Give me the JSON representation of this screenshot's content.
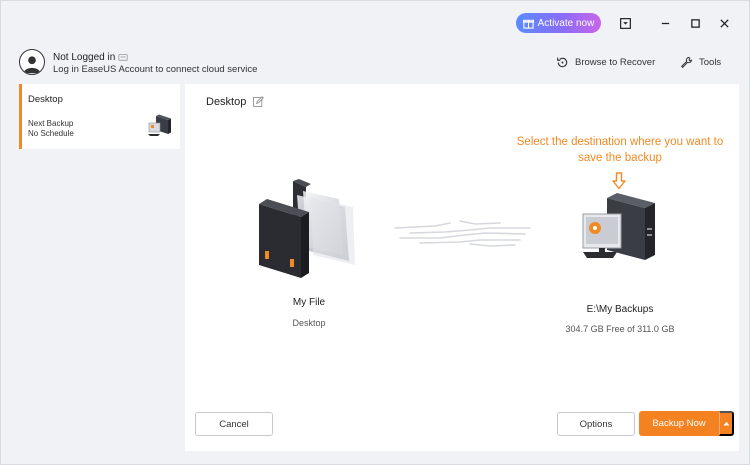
{
  "titlebar": {
    "activate_label": "Activate now"
  },
  "account": {
    "name": "Not Logged in",
    "subtitle": "Log in EaseUS Account to connect cloud service"
  },
  "top_actions": {
    "browse_label": "Browse to Recover",
    "tools_label": "Tools"
  },
  "sidebar": {
    "task": {
      "title": "Desktop",
      "next_backup_label": "Next Backup",
      "schedule_label": "No Schedule"
    }
  },
  "main": {
    "title": "Desktop",
    "source": {
      "name": "My File",
      "sub": "Desktop"
    },
    "destination": {
      "hint": "Select the destination where you want to save the backup",
      "name": "E:\\My Backups",
      "space": "304.7 GB Free of 311.0 GB"
    },
    "buttons": {
      "cancel": "Cancel",
      "options": "Options",
      "backup_now": "Backup Now"
    }
  },
  "icons": {
    "activate": "gift-icon",
    "dropdown_menu": "menu-dropdown-icon",
    "minimize": "minimize-icon",
    "maximize": "maximize-icon",
    "close": "close-icon",
    "avatar": "user-avatar-icon",
    "cloud": "cloud-icon",
    "browse": "restore-icon",
    "tools": "wrench-icon",
    "edit": "edit-icon",
    "source": "file-folder-icon",
    "destination": "computer-disk-icon",
    "arrow": "arrow-down-icon"
  },
  "colors": {
    "accent": "#f58220",
    "hint": "#f08a24",
    "activate_gradient_start": "#5b8cff",
    "activate_gradient_end": "#c866e8"
  }
}
